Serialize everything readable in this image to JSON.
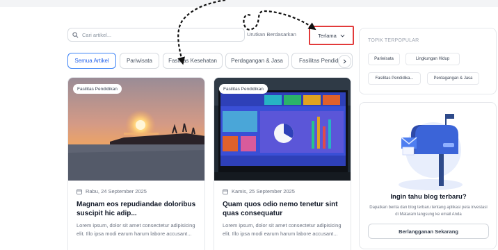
{
  "search": {
    "placeholder": "Cari artikel..."
  },
  "sort": {
    "label": "Urutkan Berdasarkan",
    "selected": "Terlama"
  },
  "chips": [
    "Semua Artikel",
    "Pariwisata",
    "Fasilitas Kesehatan",
    "Perdagangan & Jasa",
    "Fasilitas Pendidikan"
  ],
  "articles": [
    {
      "badge": "Fasilitas Pendidikan",
      "date": "Rabu, 24 September 2025",
      "title": "Magnam eos repudiandae doloribus suscipit hic adip...",
      "excerpt": "Lorem ipsum, dolor sit amet consectetur adipisicing elit. Illo ipsa modi earum harum labore accusant..."
    },
    {
      "badge": "Fasilitas Pendidikan",
      "date": "Kamis, 25 September 2025",
      "title": "Quam quos odio nemo tenetur sint quas consequatur",
      "excerpt": "Lorem ipsum, dolor sit amet consectetur adipisicing elit. Illo ipsa modi earum harum labore accusant..."
    }
  ],
  "popular": {
    "heading": "TOPIK TERPOPULAR",
    "tags": [
      "Pariwisata",
      "Lingkungan Hidup",
      "Fasilitas Pendidika...",
      "Perdagangan & Jasa"
    ]
  },
  "subscribe": {
    "heading": "Ingin tahu blog terbaru?",
    "description": "Dapatkan berita dan blog terbaru tentang aplikasi peta investasi di Mataram langsung ke email Anda",
    "button": "Berlangganan Sekarang"
  },
  "colors": {
    "accent": "#3b82f6",
    "highlight": "#e23a3a"
  }
}
